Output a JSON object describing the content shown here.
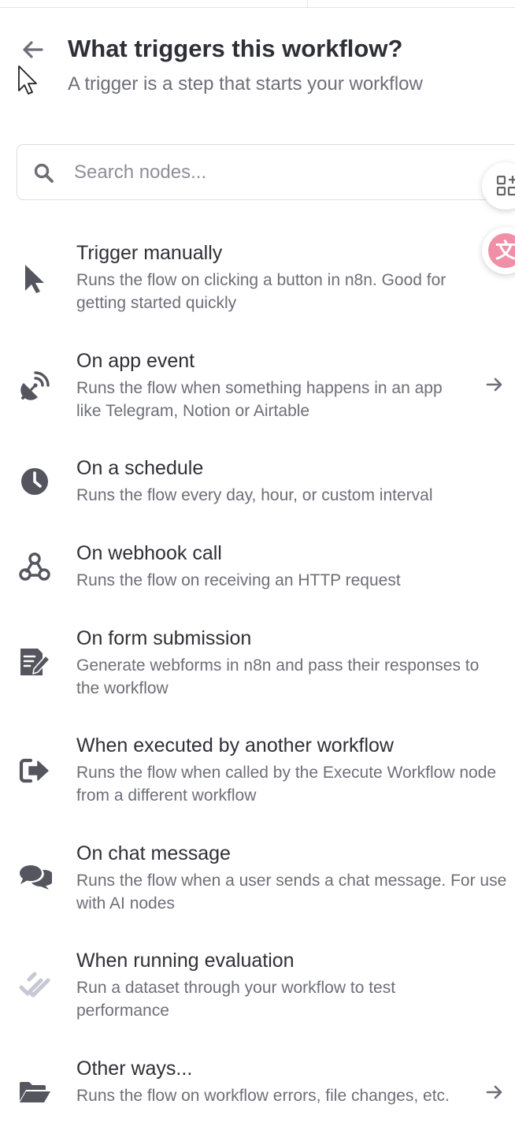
{
  "header": {
    "title": "What triggers this workflow?",
    "subtitle": "A trigger is a step that starts your workflow"
  },
  "search": {
    "placeholder": "Search nodes...",
    "value": ""
  },
  "floating_buttons": {
    "translate_glyph": "文"
  },
  "icons": {
    "back": "arrow-left-icon",
    "search": "magnifier-icon",
    "item_arrow": "arrow-right-icon"
  },
  "colors": {
    "icon_dark": "#55555f",
    "icon_light": "#c6c8d3",
    "translate_pink": "#f08fa6"
  },
  "items": [
    {
      "title": "Trigger manually",
      "description": "Runs the flow on clicking a button in n8n. Good for getting started quickly",
      "icon": "mouse-pointer-icon"
    },
    {
      "title": "On app event",
      "description": "Runs the flow when something happens in an app like Telegram, Notion or Airtable",
      "icon": "satellite-dish-icon"
    },
    {
      "title": "On a schedule",
      "description": "Runs the flow every day, hour, or custom interval",
      "icon": "clock-icon"
    },
    {
      "title": "On webhook call",
      "description": "Runs the flow on receiving an HTTP request",
      "icon": "webhook-icon"
    },
    {
      "title": "On form submission",
      "description": "Generate webforms in n8n and pass their responses to the workflow",
      "icon": "form-edit-icon"
    },
    {
      "title": "When executed by another workflow",
      "description": "Runs the flow when called by the Execute Workflow node from a different workflow",
      "icon": "sign-out-icon"
    },
    {
      "title": "On chat message",
      "description": "Runs the flow when a user sends a chat message. For use with AI nodes",
      "icon": "comments-icon"
    },
    {
      "title": "When running evaluation",
      "description": "Run a dataset through your workflow to test performance",
      "icon": "check-double-icon"
    },
    {
      "title": "Other ways...",
      "description": "Runs the flow on workflow errors, file changes, etc.",
      "icon": "folder-open-icon"
    }
  ]
}
